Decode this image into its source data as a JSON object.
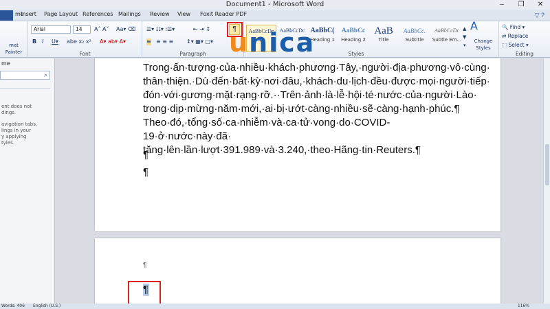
{
  "window": {
    "title": "Document1 - Microsoft Word",
    "controls": [
      "–",
      "❐",
      "✕"
    ]
  },
  "tabs": [
    "File",
    "Home",
    "Insert",
    "Page Layout",
    "References",
    "Mailings",
    "Review",
    "View",
    "Foxit Reader PDF"
  ],
  "ribbon": {
    "clipboard": {
      "format_painter": "mat Painter"
    },
    "font": {
      "name": "Arial",
      "size": "14",
      "label": "Font"
    },
    "paragraph": {
      "label": "Paragraph",
      "show_marks": "¶"
    },
    "styles": {
      "label": "Styles",
      "items": [
        {
          "sample": "AaBbCcDc",
          "name": "¶ Normal"
        },
        {
          "sample": "AaBbCcDc",
          "name": "¶ No Spaci..."
        },
        {
          "sample": "AaBbC(",
          "name": "Heading 1"
        },
        {
          "sample": "AaBbCc",
          "name": "Heading 2"
        },
        {
          "sample": "AaB",
          "name": "Title"
        },
        {
          "sample": "AaBbCc.",
          "name": "Subtitle"
        },
        {
          "sample": "AaBbCcDc",
          "name": "Subtle Em..."
        }
      ],
      "change_styles": "Change Styles"
    },
    "editing": {
      "label": "Editing",
      "find": "Find",
      "replace": "Replace",
      "select": "Select"
    }
  },
  "watermark": {
    "u": "u",
    "rest": "nica"
  },
  "nav_pane": {
    "header": "me",
    "text1": "ent does not\ndings.",
    "text2": "avigation tabs,\nlings in your\ny applying\ntyles."
  },
  "document": {
    "para1": "Trong·ấn·tượng·của·nhiều·khách·phương·Tây,·người·địa·phương·vô·cùng· thân·thiện.·Dù·đến·bất·kỳ·nơi·đâu,·khách·du·lịch·đều·được·mọi·người·tiếp· đón·với·gương·mặt·rạng·rỡ.··Trên·ảnh·là·lễ·hội·té·nước·của·người·Lào· trong·dịp·mừng·năm·mới,·ai·bị·ướt·càng·nhiều·sẽ·càng·hạnh·phúc.¶",
    "para2": "Theo·đó,·tổng·số·ca·nhiễm·và·ca·tử·vong·do·COVID-19·ở·nước·này·đã· tăng·lên·lần·lượt·391.989·và·3.240,·theo·Hãng·tin·Reuters.¶",
    "pilcrow": "¶"
  },
  "status": {
    "words": "Words: 406",
    "language": "English (U.S.)",
    "zoom": "116%"
  }
}
